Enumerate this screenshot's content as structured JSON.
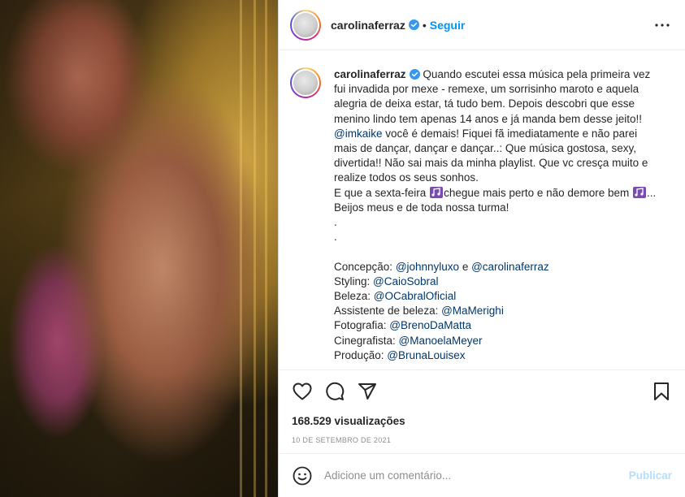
{
  "post": {
    "username": "carolinaferraz",
    "follow_label": "Seguir",
    "media_alt": "video frame"
  },
  "caption": {
    "username": "carolinaferraz",
    "text_1": "Quando escutei essa música pela primeira vez fui invadida por mexe - remexe, um sorrisinho maroto e aquela alegria de deixa estar, tá tudo bem. Depois descobri que esse menino lindo tem apenas 14 anos e já manda bem desse jeito!! ",
    "mention_1": "@imkaike",
    "text_2": " você é demais! Fiquei fã imediatamente e não parei mais de dançar, dançar e dançar..: Que música gostosa, sexy, divertida!! Não sai mais da minha playlist. Que vc cresça muito e realize todos os seus sonhos.",
    "text_3a": "E que a sexta-feira ",
    "text_3b": "chegue mais perto e não demore bem ",
    "text_3c": "...",
    "text_4": "Beijos meus e de toda nossa turma!",
    "dot_1": ".",
    "dot_2": ".",
    "credits": [
      {
        "label": "Concepção: ",
        "mention": "@johnnyluxo",
        "joiner": " e ",
        "mention2": "@carolinaferraz"
      },
      {
        "label": "Styling: ",
        "mention": "@CaioSobral"
      },
      {
        "label": "Beleza: ",
        "mention": "@OCabralOficial"
      },
      {
        "label": "Assistente de beleza: ",
        "mention": "@MaMerighi"
      },
      {
        "label": "Fotografia: ",
        "mention": "@BrenoDaMatta"
      },
      {
        "label": "Cinegrafista: ",
        "mention": "@ManoelaMeyer"
      },
      {
        "label": "Produção: ",
        "mention": "@BrunaLouisex"
      }
    ]
  },
  "stats": {
    "views": "168.529 visualizações",
    "date": "10 DE SETEMBRO DE 2021"
  },
  "comment": {
    "placeholder": "Adicione um comentário...",
    "publish_label": "Publicar"
  },
  "colors": {
    "follow": "#0095f6",
    "mention": "#00376b",
    "verified": "#3897f0",
    "publish_disabled": "#b2dffc",
    "meta_gray": "#8e8e8e"
  },
  "icons": {
    "verified": "verified-badge-icon",
    "more": "more-options-icon",
    "like": "heart-icon",
    "comment": "speech-bubble-icon",
    "share": "paper-plane-icon",
    "save": "bookmark-icon",
    "emoji": "smiley-icon",
    "music": "music-note-icon"
  }
}
